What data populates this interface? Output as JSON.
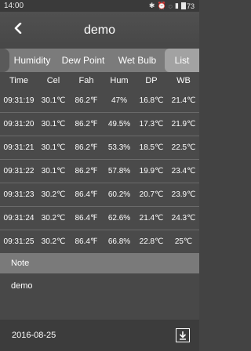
{
  "status_bar": {
    "time": "14:00",
    "battery": "73"
  },
  "header": {
    "title": "demo"
  },
  "tabs": [
    {
      "label": "Humidity",
      "active": false
    },
    {
      "label": "Dew Point",
      "active": false
    },
    {
      "label": "Wet Bulb",
      "active": false
    },
    {
      "label": "List",
      "active": true
    }
  ],
  "table": {
    "columns": [
      "Time",
      "Cel",
      "Fah",
      "Hum",
      "DP",
      "WB"
    ],
    "rows": [
      [
        "09:31:19",
        "30.1℃",
        "86.2℉",
        "47%",
        "16.8℃",
        "21.4℃"
      ],
      [
        "09:31:20",
        "30.1℃",
        "86.2℉",
        "49.5%",
        "17.3℃",
        "21.9℃"
      ],
      [
        "09:31:21",
        "30.1℃",
        "86.2℉",
        "53.3%",
        "18.5℃",
        "22.5℃"
      ],
      [
        "09:31:22",
        "30.1℃",
        "86.2℉",
        "57.8%",
        "19.9℃",
        "23.4℃"
      ],
      [
        "09:31:23",
        "30.2℃",
        "86.4℉",
        "60.2%",
        "20.7℃",
        "23.9℃"
      ],
      [
        "09:31:24",
        "30.2℃",
        "86.4℉",
        "62.6%",
        "21.4℃",
        "24.3℃"
      ],
      [
        "09:31:25",
        "30.2℃",
        "86.4℉",
        "66.8%",
        "22.8℃",
        "25℃"
      ]
    ]
  },
  "note": {
    "header": "Note",
    "text": "demo"
  },
  "footer": {
    "date": "2016-08-25"
  },
  "colors": {
    "background": "#434343",
    "tab_bar": "#7b7b7b",
    "tab_active": "#a2a2a2",
    "note_header": "#7a7a7a"
  },
  "icons": {
    "back": "chevron-left-icon",
    "download": "download-icon"
  }
}
